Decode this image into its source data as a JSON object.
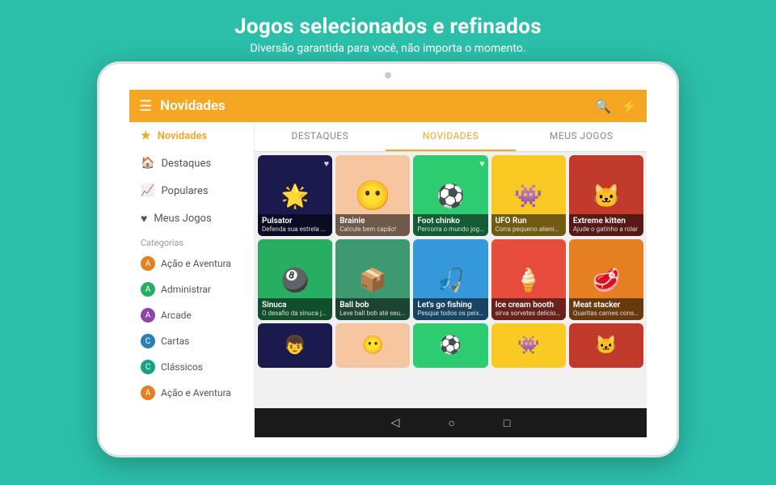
{
  "headline": "Jogos selecionados e refinados",
  "subline": "Diversão garantida para você,  não importa o momento.",
  "topbar": {
    "menu_icon": "☰",
    "title": "Novidades",
    "search_icon": "🔍",
    "bolt_icon": "⚡"
  },
  "sidebar": {
    "items": [
      {
        "label": "Novidades",
        "icon": "★",
        "active": true
      },
      {
        "label": "Destaques",
        "icon": "🏠",
        "active": false
      },
      {
        "label": "Populares",
        "icon": "📈",
        "active": false
      },
      {
        "label": "Meus Jogos",
        "icon": "♥",
        "active": false
      }
    ],
    "categories_label": "Categorias",
    "categories": [
      {
        "label": "Ação e Aventura",
        "color": "#e67e22"
      },
      {
        "label": "Administrar",
        "color": "#27ae60"
      },
      {
        "label": "Arcade",
        "color": "#8e44ad"
      },
      {
        "label": "Cartas",
        "color": "#2980b9"
      },
      {
        "label": "Clássicos",
        "color": "#16a085"
      },
      {
        "label": "Ação e Aventura",
        "color": "#e67e22"
      }
    ]
  },
  "tabs": [
    {
      "label": "DESTAQUES",
      "active": false
    },
    {
      "label": "NOVIDADES",
      "active": true
    },
    {
      "label": "MEUS JOGOS",
      "active": false
    }
  ],
  "games_row1": [
    {
      "title": "Pulsator",
      "desc": "Defenda sua estrela ...",
      "bg": "#1a1a4e",
      "emoji": "🌟",
      "heart": true
    },
    {
      "title": "Brainie",
      "desc": "Calcule bem capão!",
      "bg": "#f5c6a0",
      "emoji": "😶",
      "heart": false
    },
    {
      "title": "Foot chinko",
      "desc": "Percorra o mundo jogando!",
      "bg": "#2ecc71",
      "emoji": "⚽",
      "heart": true
    },
    {
      "title": "UFO Run",
      "desc": "Corra pequeno alienigena!",
      "bg": "#f9ca24",
      "emoji": "👾",
      "heart": false
    },
    {
      "title": "Extreme kitten",
      "desc": "Ajude o gatinho a rolar",
      "bg": "#c0392b",
      "emoji": "🐱",
      "heart": false
    }
  ],
  "games_row2": [
    {
      "title": "Sinuca",
      "desc": "O desafio da sinuca já ...",
      "bg": "#27ae60",
      "emoji": "🎱",
      "heart": false
    },
    {
      "title": "Ball bob",
      "desc": "Leve ball bob até seu...",
      "bg": "#3d9970",
      "emoji": "📦",
      "heart": false
    },
    {
      "title": "Let's go fishing",
      "desc": "Pesque todos os peixes...",
      "bg": "#3498db",
      "emoji": "🎣",
      "heart": false
    },
    {
      "title": "Ice cream booth",
      "desc": "sirva sorvetes deliciosos...",
      "bg": "#e74c3c",
      "emoji": "🍦",
      "heart": false
    },
    {
      "title": "Meat stacker",
      "desc": "Quaritas carnes conseque...",
      "bg": "#e67e22",
      "emoji": "🥩",
      "heart": false
    }
  ],
  "games_row3": [
    {
      "title": "",
      "desc": "",
      "bg": "#1a1a4e",
      "emoji": "👦",
      "heart": false
    },
    {
      "title": "",
      "desc": "",
      "bg": "#f5c6a0",
      "emoji": "😶",
      "heart": false
    },
    {
      "title": "",
      "desc": "",
      "bg": "#2ecc71",
      "emoji": "⚽",
      "heart": false
    },
    {
      "title": "",
      "desc": "",
      "bg": "#f9ca24",
      "emoji": "👾",
      "heart": false
    },
    {
      "title": "",
      "desc": "",
      "bg": "#c0392b",
      "emoji": "🐱",
      "heart": false
    }
  ],
  "android_nav": {
    "back": "◁",
    "home": "○",
    "recent": "□"
  }
}
